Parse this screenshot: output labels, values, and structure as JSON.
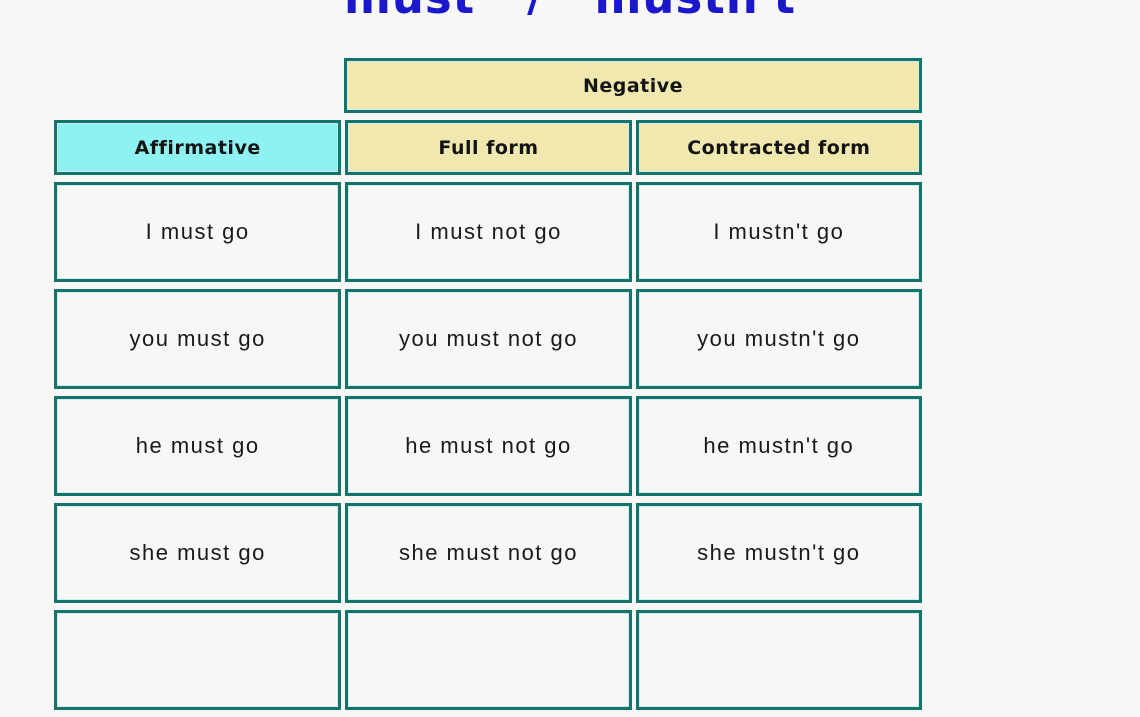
{
  "title": {
    "left": "must",
    "separator": "/",
    "right": "mustn't"
  },
  "colors": {
    "title_blue": "#1b18cc",
    "header_cream": "#f0e8ae",
    "header_cyan": "#8ef2f2",
    "border_teal": "#14736b",
    "page_background": "#f7f7f5",
    "cell_background": "#f7f7f5"
  },
  "table": {
    "group_header": {
      "negative": "Negative"
    },
    "column_headers": [
      "Affirmative",
      "Full   form",
      "Contracted   form"
    ],
    "rows": [
      {
        "affirmative": "I must go",
        "full_form": "I must not go",
        "contracted_form": "I mustn't go"
      },
      {
        "affirmative": "you must go",
        "full_form": "you must not go",
        "contracted_form": "you mustn't go"
      },
      {
        "affirmative": "he must go",
        "full_form": "he must not go",
        "contracted_form": "he mustn't go"
      },
      {
        "affirmative": "she must go",
        "full_form": "she must not go",
        "contracted_form": "she mustn't go"
      },
      {
        "affirmative": "",
        "full_form": "",
        "contracted_form": ""
      }
    ]
  }
}
